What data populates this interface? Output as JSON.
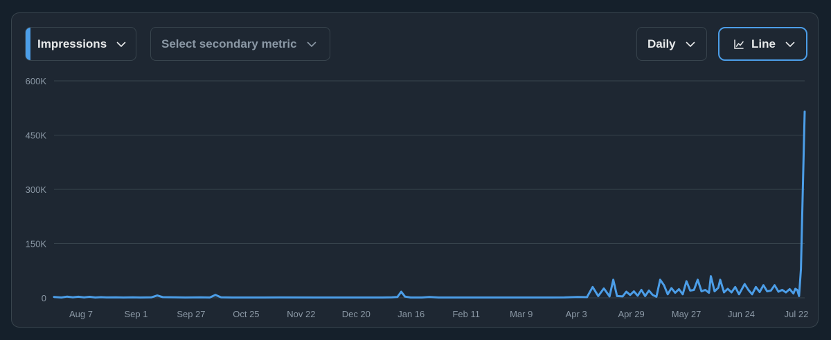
{
  "controls": {
    "primary_metric": "Impressions",
    "secondary_metric_placeholder": "Select secondary metric",
    "period": "Daily",
    "chart_type": "Line"
  },
  "colors": {
    "accent": "#4c9ee8",
    "line": "#4c9ee8",
    "grid": "#38444d",
    "panel": "#1e2732",
    "page": "#15202b",
    "axis_text": "#8b98a5"
  },
  "chart_data": {
    "type": "line",
    "title": "",
    "xlabel": "",
    "ylabel": "",
    "ylim": [
      0,
      600000
    ],
    "y_ticks": [
      {
        "value": 600000,
        "label": "600K"
      },
      {
        "value": 450000,
        "label": "450K"
      },
      {
        "value": 300000,
        "label": "300K"
      },
      {
        "value": 150000,
        "label": "150K"
      },
      {
        "value": 0,
        "label": "0"
      }
    ],
    "x_ticks": [
      "Aug 7",
      "Sep 1",
      "Sep 27",
      "Oct 25",
      "Nov 22",
      "Dec 20",
      "Jan 16",
      "Feb 11",
      "Mar 9",
      "Apr 3",
      "Apr 29",
      "May 27",
      "Jun 24",
      "Jul 22"
    ],
    "x_range": [
      "Jul 26",
      "Jul 22"
    ],
    "grid": true,
    "legend": "none",
    "series": [
      {
        "values": [
          [
            0,
            2500
          ],
          [
            4,
            1000
          ],
          [
            7,
            3500
          ],
          [
            10,
            1500
          ],
          [
            13,
            3000
          ],
          [
            16,
            1200
          ],
          [
            19,
            2800
          ],
          [
            22,
            1000
          ],
          [
            25,
            2000
          ],
          [
            28,
            1200
          ],
          [
            33,
            1500
          ],
          [
            37,
            1000
          ],
          [
            42,
            1500
          ],
          [
            46,
            1000
          ],
          [
            52,
            1500
          ],
          [
            55,
            6500
          ],
          [
            58,
            2000
          ],
          [
            65,
            1500
          ],
          [
            70,
            1000
          ],
          [
            78,
            1500
          ],
          [
            83,
            1000
          ],
          [
            86,
            8000
          ],
          [
            89,
            1500
          ],
          [
            95,
            1000
          ],
          [
            110,
            1000
          ],
          [
            120,
            1200
          ],
          [
            140,
            1000
          ],
          [
            160,
            1000
          ],
          [
            175,
            1000
          ],
          [
            180,
            1500
          ],
          [
            183,
            2500
          ],
          [
            185,
            17000
          ],
          [
            187,
            3500
          ],
          [
            190,
            1000
          ],
          [
            196,
            1000
          ],
          [
            200,
            2500
          ],
          [
            205,
            1000
          ],
          [
            215,
            1000
          ],
          [
            230,
            1000
          ],
          [
            250,
            1000
          ],
          [
            265,
            1000
          ],
          [
            272,
            1200
          ],
          [
            279,
            2500
          ],
          [
            284,
            2000
          ],
          [
            287,
            30000
          ],
          [
            290,
            5000
          ],
          [
            293,
            26000
          ],
          [
            296,
            4000
          ],
          [
            298,
            50000
          ],
          [
            300,
            5000
          ],
          [
            303,
            4000
          ],
          [
            305,
            17000
          ],
          [
            307,
            8000
          ],
          [
            309,
            18000
          ],
          [
            311,
            6000
          ],
          [
            313,
            22000
          ],
          [
            315,
            5000
          ],
          [
            317,
            20000
          ],
          [
            319,
            8000
          ],
          [
            321,
            3000
          ],
          [
            323,
            50000
          ],
          [
            325,
            35000
          ],
          [
            327,
            10000
          ],
          [
            329,
            27000
          ],
          [
            331,
            14000
          ],
          [
            333,
            24000
          ],
          [
            335,
            10000
          ],
          [
            337,
            46000
          ],
          [
            339,
            20000
          ],
          [
            341,
            22000
          ],
          [
            343,
            50000
          ],
          [
            345,
            18000
          ],
          [
            347,
            22000
          ],
          [
            349,
            14000
          ],
          [
            350,
            60000
          ],
          [
            352,
            18000
          ],
          [
            354,
            28000
          ],
          [
            355,
            50000
          ],
          [
            357,
            15000
          ],
          [
            359,
            25000
          ],
          [
            361,
            15000
          ],
          [
            363,
            30000
          ],
          [
            365,
            10000
          ],
          [
            368,
            38000
          ],
          [
            370,
            22000
          ],
          [
            372,
            10000
          ],
          [
            374,
            30000
          ],
          [
            376,
            16000
          ],
          [
            378,
            35000
          ],
          [
            380,
            18000
          ],
          [
            382,
            20000
          ],
          [
            384,
            35000
          ],
          [
            386,
            17000
          ],
          [
            388,
            22000
          ],
          [
            390,
            15000
          ],
          [
            392,
            24000
          ],
          [
            394,
            12000
          ],
          [
            395,
            25000
          ],
          [
            396,
            22000
          ],
          [
            397,
            5000
          ],
          [
            398,
            80000
          ],
          [
            399,
            300000
          ],
          [
            400,
            515000
          ]
        ]
      }
    ]
  }
}
